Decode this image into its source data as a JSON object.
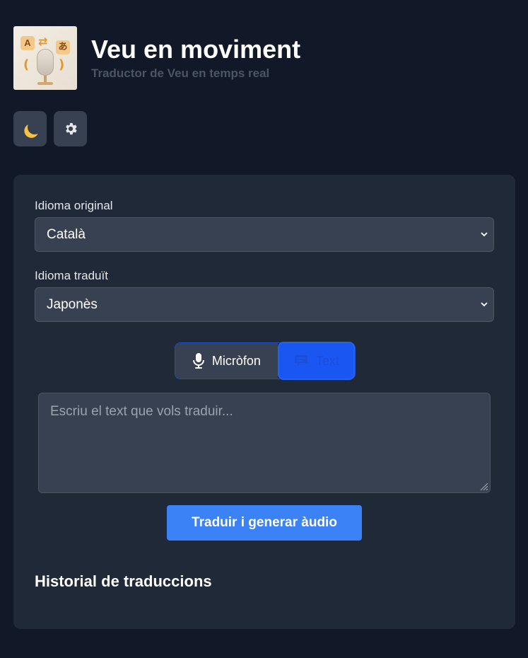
{
  "app": {
    "title": "Veu en moviment",
    "subtitle": "Traductor de Veu en temps real",
    "logo_tiles": {
      "left": "A",
      "right": "あ"
    }
  },
  "toolbar": {
    "theme_icon": "moon-icon",
    "settings_icon": "gear-icon"
  },
  "form": {
    "source_label": "Idioma original",
    "source_value": "Català",
    "target_label": "Idioma traduït",
    "target_value": "Japonès",
    "mode_microphone_label": "Micròfon",
    "mode_text_label": "Text",
    "active_mode": "Text",
    "text_placeholder": "Escriu el text que vols traduir...",
    "text_value": "",
    "submit_label": "Traduir i generar àudio"
  },
  "history": {
    "title": "Historial de traduccions"
  },
  "colors": {
    "background": "#111827",
    "card": "#1f2937",
    "accent": "#3b82f6",
    "active_segment": "#1a56f2"
  }
}
